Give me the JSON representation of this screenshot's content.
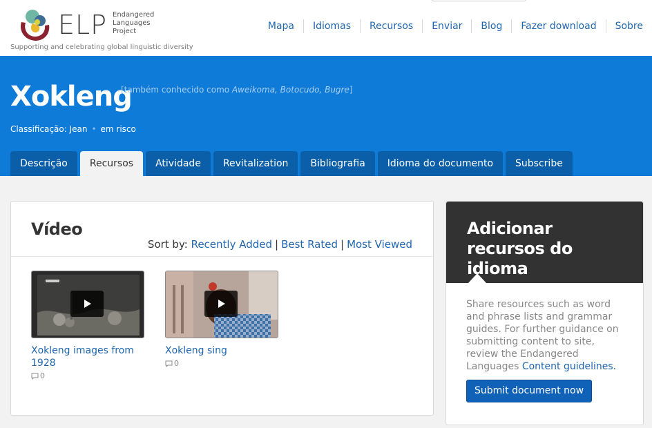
{
  "header": {
    "logo_text": "ELP",
    "logo_subtitle": "Endangered Languages Project",
    "tagline": "Supporting and celebrating global linguistic diversity",
    "nav": [
      "Mapa",
      "Idiomas",
      "Recursos",
      "Enviar",
      "Blog",
      "Fazer download",
      "Sobre"
    ]
  },
  "language": {
    "title": "Xokleng",
    "aka_prefix": "[também conhecido como ",
    "aka_names": "Aweikoma, Botocudo, Bugre",
    "aka_suffix": "]",
    "classification_label": "Classificação: Jean",
    "classification_dot": "•",
    "status": "em risco"
  },
  "tabs": {
    "items": [
      "Descrição",
      "Recursos",
      "Atividade",
      "Revitalization",
      "Bibliografia",
      "Idioma do documento",
      "Subscribe"
    ],
    "active": "Recursos"
  },
  "main": {
    "section_title": "Vídeo",
    "sort_label": "Sort by: ",
    "sort_options": [
      "Recently Added",
      "Best Rated",
      "Most Viewed"
    ],
    "sort_separator": "|",
    "videos": [
      {
        "title": "Xokleng images from 1928",
        "comments": "0"
      },
      {
        "title": "Xokleng sing",
        "comments": "0"
      }
    ]
  },
  "sidebar": {
    "title": "Adicionar recursos do idioma",
    "text": "Share resources such as word and phrase lists and grammar guides. For further guidance on submitting content to site, review the Endangered Languages ",
    "link_text": "Content guidelines.",
    "button_label": "Submit document now"
  },
  "colors": {
    "banner": "#0f7bd8",
    "link": "#1f66b0",
    "tab": "#0b5ea8",
    "sidebar_header": "#323232",
    "button": "#0f62b8"
  }
}
